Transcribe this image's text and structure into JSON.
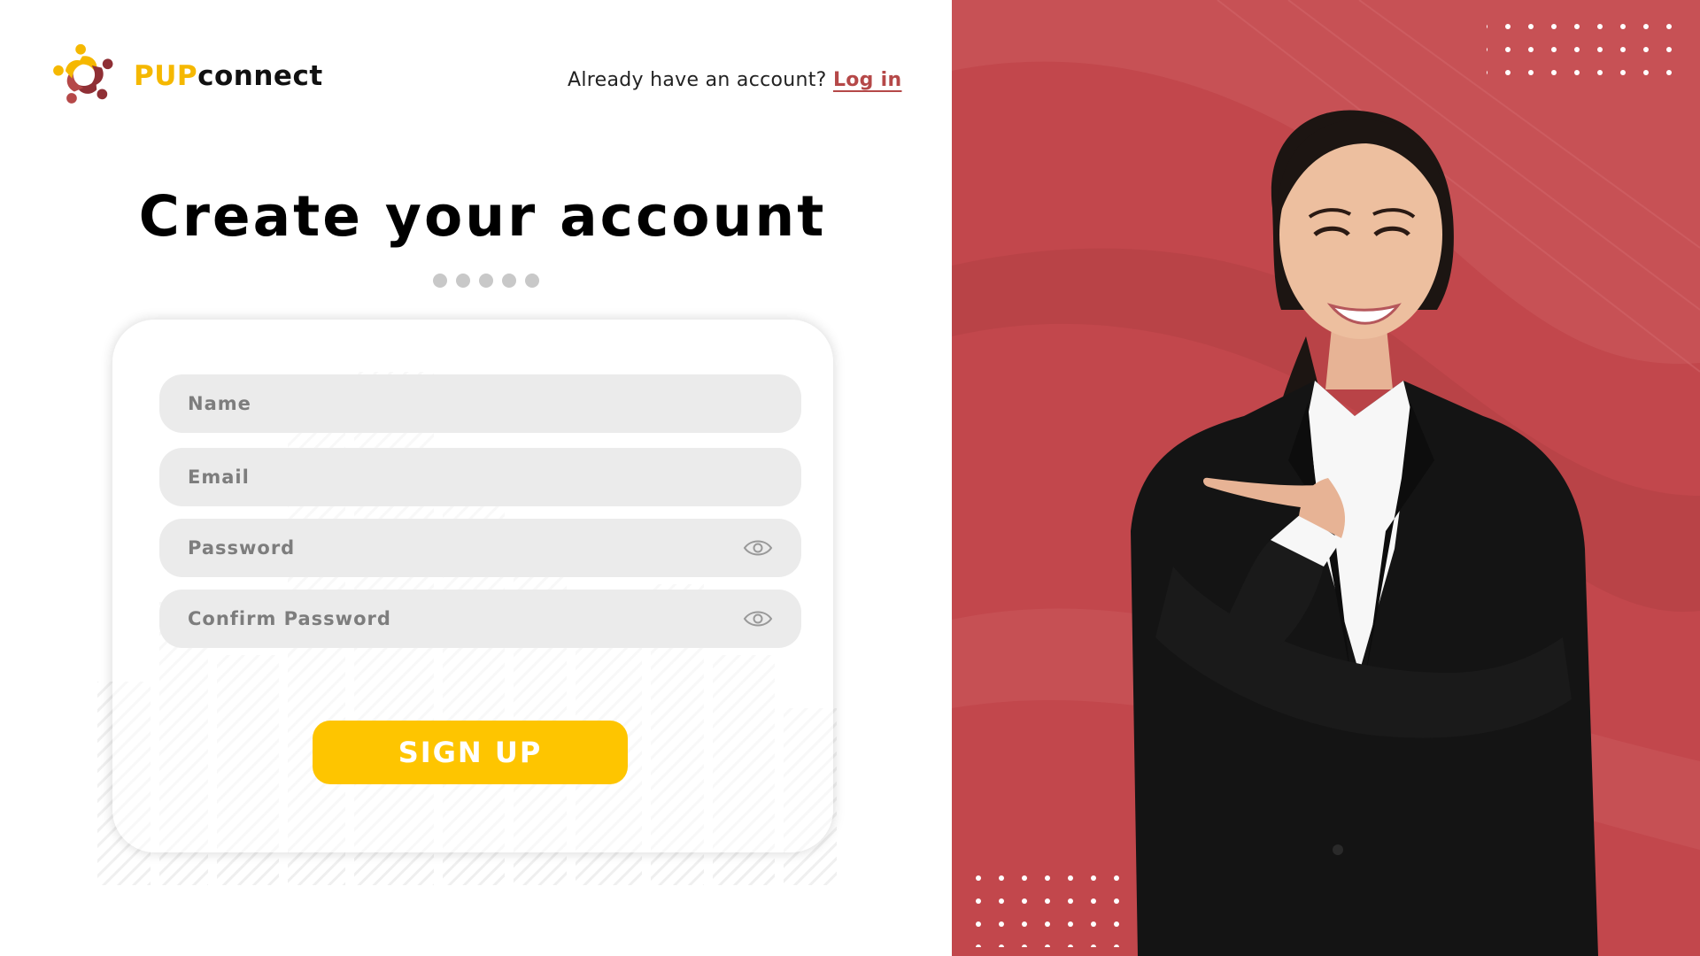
{
  "brand": {
    "part1": "PUP",
    "part2": "connect"
  },
  "header": {
    "prompt": "Already have an account?",
    "login_label": "Log in"
  },
  "main": {
    "title": "Create your account",
    "step_dots": 5
  },
  "form": {
    "name_placeholder": "Name",
    "email_placeholder": "Email",
    "password_placeholder": "Password",
    "confirm_placeholder": "Confirm Password",
    "signup_label": "SIGN UP"
  },
  "colors": {
    "brand_yellow": "#f5b800",
    "button_yellow": "#fec500",
    "accent_red": "#b54848",
    "panel_red": "#c2474c"
  },
  "icons": [
    "logo-people-icon",
    "eye-icon",
    "eye-icon"
  ]
}
